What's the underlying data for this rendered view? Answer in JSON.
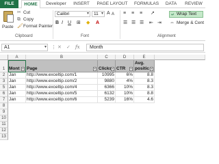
{
  "tabs": [
    "FILE",
    "HOME",
    "Developer",
    "INSERT",
    "PAGE LAYOUT",
    "FORMULAS",
    "DATA",
    "REVIEW"
  ],
  "active_tab": "HOME",
  "clipboard": {
    "paste": "Paste",
    "cut": "Cut",
    "copy": "Copy",
    "format_painter": "Format Painter",
    "group_label": "Clipboard"
  },
  "font": {
    "name": "Calibri",
    "size": "11",
    "bold": "B",
    "italic": "I",
    "underline": "U",
    "group_label": "Font"
  },
  "alignment": {
    "wrap_text": "Wrap Text",
    "merge_center": "Merge & Cent",
    "group_label": "Alignment"
  },
  "formula_bar": {
    "name_box": "A1",
    "fx": "fx",
    "value": "Month"
  },
  "columns": [
    "A",
    "B",
    "C",
    "D",
    "E"
  ],
  "rows": [
    "1",
    "2",
    "3",
    "5",
    "6",
    "7",
    "8",
    "9",
    "10",
    "11",
    "12",
    "13"
  ],
  "header_row": [
    "Mont",
    "Page",
    "Clicks",
    "CTR",
    "Avg. positic"
  ],
  "data_rows": [
    [
      "Jan",
      "http://www.exceltip.com/1",
      "10995",
      "6%",
      "8.8"
    ],
    [
      "Jan",
      "http://www.exceltip.com/2",
      "9880",
      "4%",
      "8.3"
    ],
    [
      "Jan",
      "http://www.exceltip.com/4",
      "6366",
      "10%",
      "8.3"
    ],
    [
      "Jan",
      "http://www.exceltip.com/5",
      "6132",
      "10%",
      "8.8"
    ],
    [
      "Jan",
      "http://www.exceltip.com/6",
      "5239",
      "16%",
      "4.6"
    ]
  ],
  "colors": {
    "accent": "#217346",
    "header_fill": "#c0c0c0",
    "wrap_active": "#c5e8c9"
  }
}
